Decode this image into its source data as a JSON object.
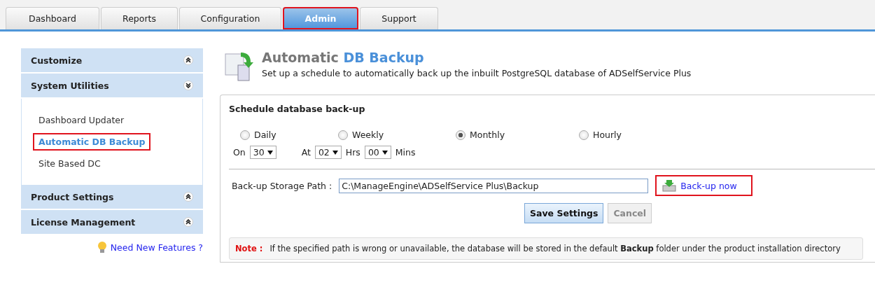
{
  "tabs": [
    {
      "label": "Dashboard",
      "selected": false,
      "highlighted": false
    },
    {
      "label": "Reports",
      "selected": false,
      "highlighted": false
    },
    {
      "label": "Configuration",
      "selected": false,
      "highlighted": false
    },
    {
      "label": "Admin",
      "selected": true,
      "highlighted": true
    },
    {
      "label": "Support",
      "selected": false,
      "highlighted": false
    }
  ],
  "sidebar": {
    "sections": [
      {
        "title": "Customize",
        "expanded": false
      },
      {
        "title": "System Utilities",
        "expanded": true,
        "items": [
          {
            "label": "Dashboard Updater",
            "selected": false,
            "highlighted": false
          },
          {
            "label": "Automatic DB Backup",
            "selected": true,
            "highlighted": true
          },
          {
            "label": "Site Based DC",
            "selected": false,
            "highlighted": false
          }
        ]
      },
      {
        "title": "Product Settings",
        "expanded": false
      },
      {
        "title": "License Management",
        "expanded": false
      }
    ],
    "feature_link": "Need New Features ?"
  },
  "header": {
    "title_prefix": "Automatic",
    "title_highlight": "DB Backup",
    "subtitle": "Set up a schedule to automatically back up the inbuilt PostgreSQL database of ADSelfService Plus"
  },
  "schedule": {
    "title": "Schedule database back-up",
    "frequencies": [
      {
        "label": "Daily",
        "selected": false
      },
      {
        "label": "Weekly",
        "selected": false
      },
      {
        "label": "Monthly",
        "selected": true
      },
      {
        "label": "Hourly",
        "selected": false
      }
    ],
    "day_label": "On",
    "day_value": "30",
    "time_label": "At",
    "hours_value": "02",
    "hours_label": "Hrs",
    "minutes_value": "00",
    "minutes_label": "Mins"
  },
  "storage": {
    "label": "Back-up Storage Path :",
    "path": "C:\\ManageEngine\\ADSelfService Plus\\Backup",
    "backup_link": "Back-up now",
    "backup_highlighted": true
  },
  "buttons": [
    {
      "label": "Save Settings",
      "kind": "primary"
    },
    {
      "label": "Cancel",
      "kind": "secondary"
    }
  ],
  "note": {
    "label": "Note :",
    "text": "If the specified path is wrong or unavailable, the database will be stored in the default **Backup** folder under the product installation directory"
  }
}
